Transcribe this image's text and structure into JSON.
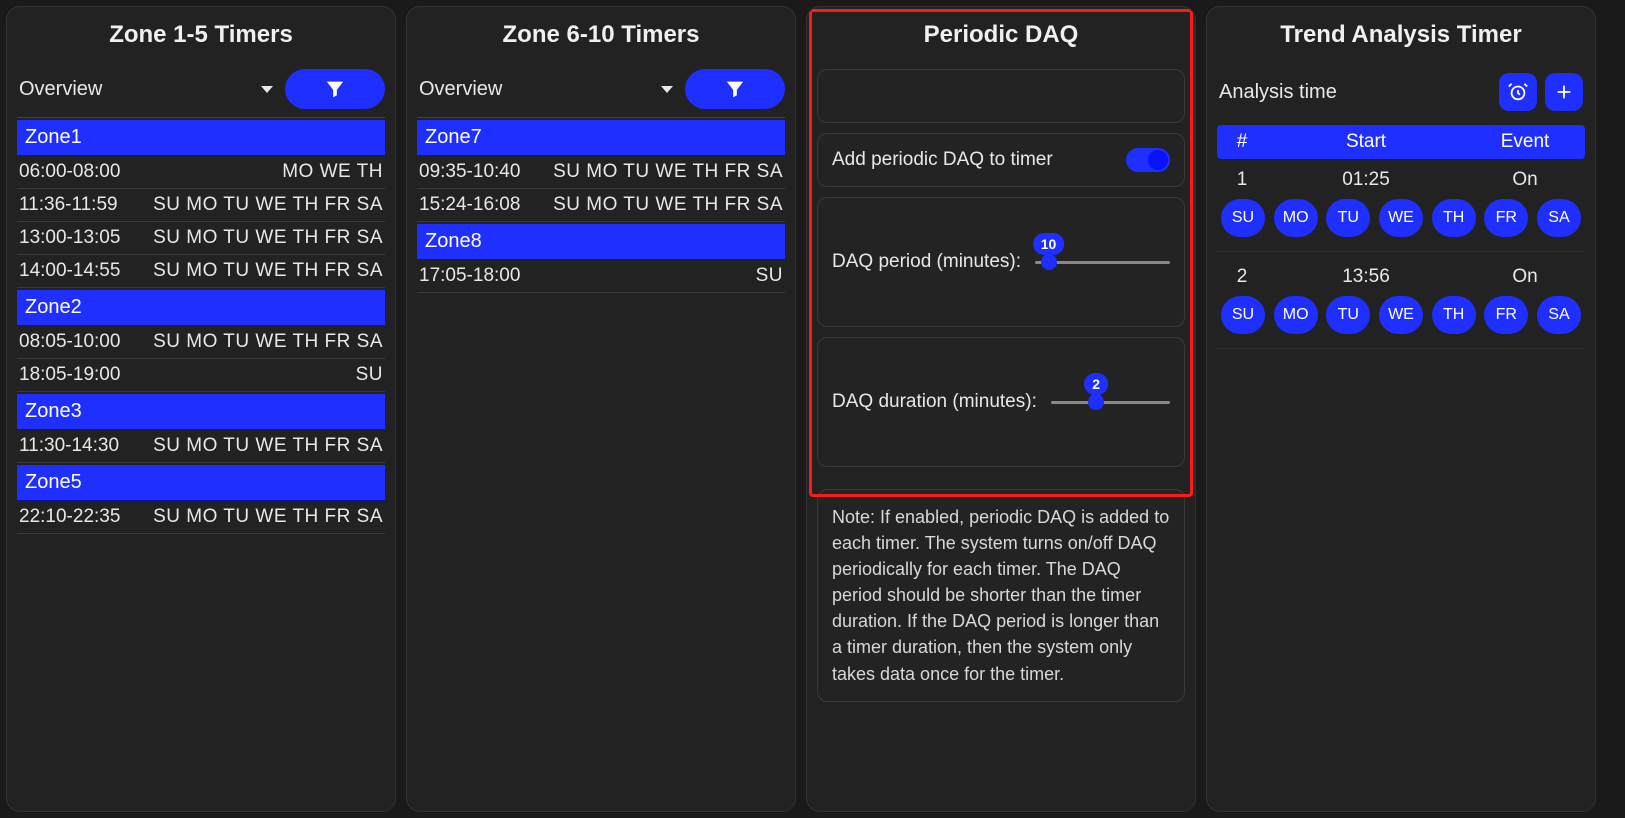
{
  "days_full": [
    "SU",
    "MO",
    "TU",
    "WE",
    "TH",
    "FR",
    "SA"
  ],
  "panels": {
    "zone15": {
      "title": "Zone 1-5 Timers",
      "dropdown": "Overview",
      "zones": [
        {
          "name": "Zone1",
          "rows": [
            {
              "time": "06:00-08:00",
              "days": "MO WE TH"
            },
            {
              "time": "11:36-11:59",
              "days": "SU MO TU WE TH FR SA"
            },
            {
              "time": "13:00-13:05",
              "days": "SU MO TU WE TH FR SA"
            },
            {
              "time": "14:00-14:55",
              "days": "SU MO TU WE TH FR SA"
            }
          ]
        },
        {
          "name": "Zone2",
          "rows": [
            {
              "time": "08:05-10:00",
              "days": "SU MO TU WE TH FR SA"
            },
            {
              "time": "18:05-19:00",
              "days": "SU"
            }
          ]
        },
        {
          "name": "Zone3",
          "rows": [
            {
              "time": "11:30-14:30",
              "days": "SU MO TU WE TH FR SA"
            }
          ]
        },
        {
          "name": "Zone5",
          "rows": [
            {
              "time": "22:10-22:35",
              "days": "SU MO TU WE TH FR SA"
            }
          ]
        }
      ]
    },
    "zone610": {
      "title": "Zone 6-10 Timers",
      "dropdown": "Overview",
      "zones": [
        {
          "name": "Zone7",
          "rows": [
            {
              "time": "09:35-10:40",
              "days": "SU MO TU WE TH FR SA"
            },
            {
              "time": "15:24-16:08",
              "days": "SU MO TU WE TH FR SA"
            }
          ]
        },
        {
          "name": "Zone8",
          "rows": [
            {
              "time": "17:05-18:00",
              "days": "SU"
            }
          ]
        }
      ]
    },
    "daq": {
      "title": "Periodic DAQ",
      "toggle_label": "Add periodic DAQ to timer",
      "toggle_on": true,
      "period_label": "DAQ period (minutes):",
      "period_value": 10,
      "period_percent": 10,
      "duration_label": "DAQ duration (minutes):",
      "duration_value": 2,
      "duration_percent": 38,
      "note": "Note: If enabled, periodic DAQ is added to each timer. The system turns on/off DAQ periodically for each timer. The DAQ period should be shorter than the timer duration. If the DAQ period is longer than a timer duration, then the system only takes data once for the timer."
    },
    "trend": {
      "title": "Trend Analysis Timer",
      "header_label": "Analysis time",
      "cols": {
        "num": "#",
        "start": "Start",
        "event": "Event"
      },
      "rows": [
        {
          "num": "1",
          "start": "01:25",
          "event": "On",
          "days": [
            "SU",
            "MO",
            "TU",
            "WE",
            "TH",
            "FR",
            "SA"
          ]
        },
        {
          "num": "2",
          "start": "13:56",
          "event": "On",
          "days": [
            "SU",
            "MO",
            "TU",
            "WE",
            "TH",
            "FR",
            "SA"
          ]
        }
      ]
    }
  }
}
